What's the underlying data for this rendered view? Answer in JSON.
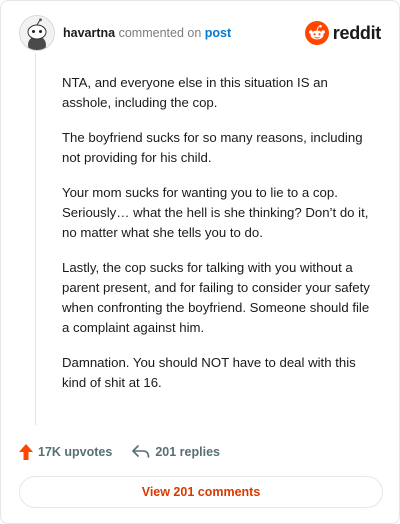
{
  "header": {
    "username": "havartna",
    "action": "commented on",
    "post_link": "post",
    "brand_word": "reddit",
    "brand_color": "#ff4500"
  },
  "comment": {
    "paragraphs": [
      "NTA, and everyone else in this situation IS an asshole, including the cop.",
      "The boyfriend sucks for so many reasons, including not providing for his child.",
      "Your mom sucks for wanting you to lie to a cop. Seriously… what the hell is she thinking? Don’t do it, no matter what she tells you to do.",
      "Lastly, the cop sucks for talking with you without a parent present, and for failing to consider your safety when confronting the boyfriend. Someone should file a complaint against him.",
      "Damnation. You should NOT have to deal with this kind of shit at 16."
    ]
  },
  "actions": {
    "upvotes": "17K upvotes",
    "replies": "201 replies",
    "upvote_icon": "upvote-arrow-icon",
    "reply_icon": "reply-arrow-icon",
    "upvote_color": "#ff4500"
  },
  "view_button": {
    "label": "View 201 comments",
    "color": "#d93a00"
  }
}
